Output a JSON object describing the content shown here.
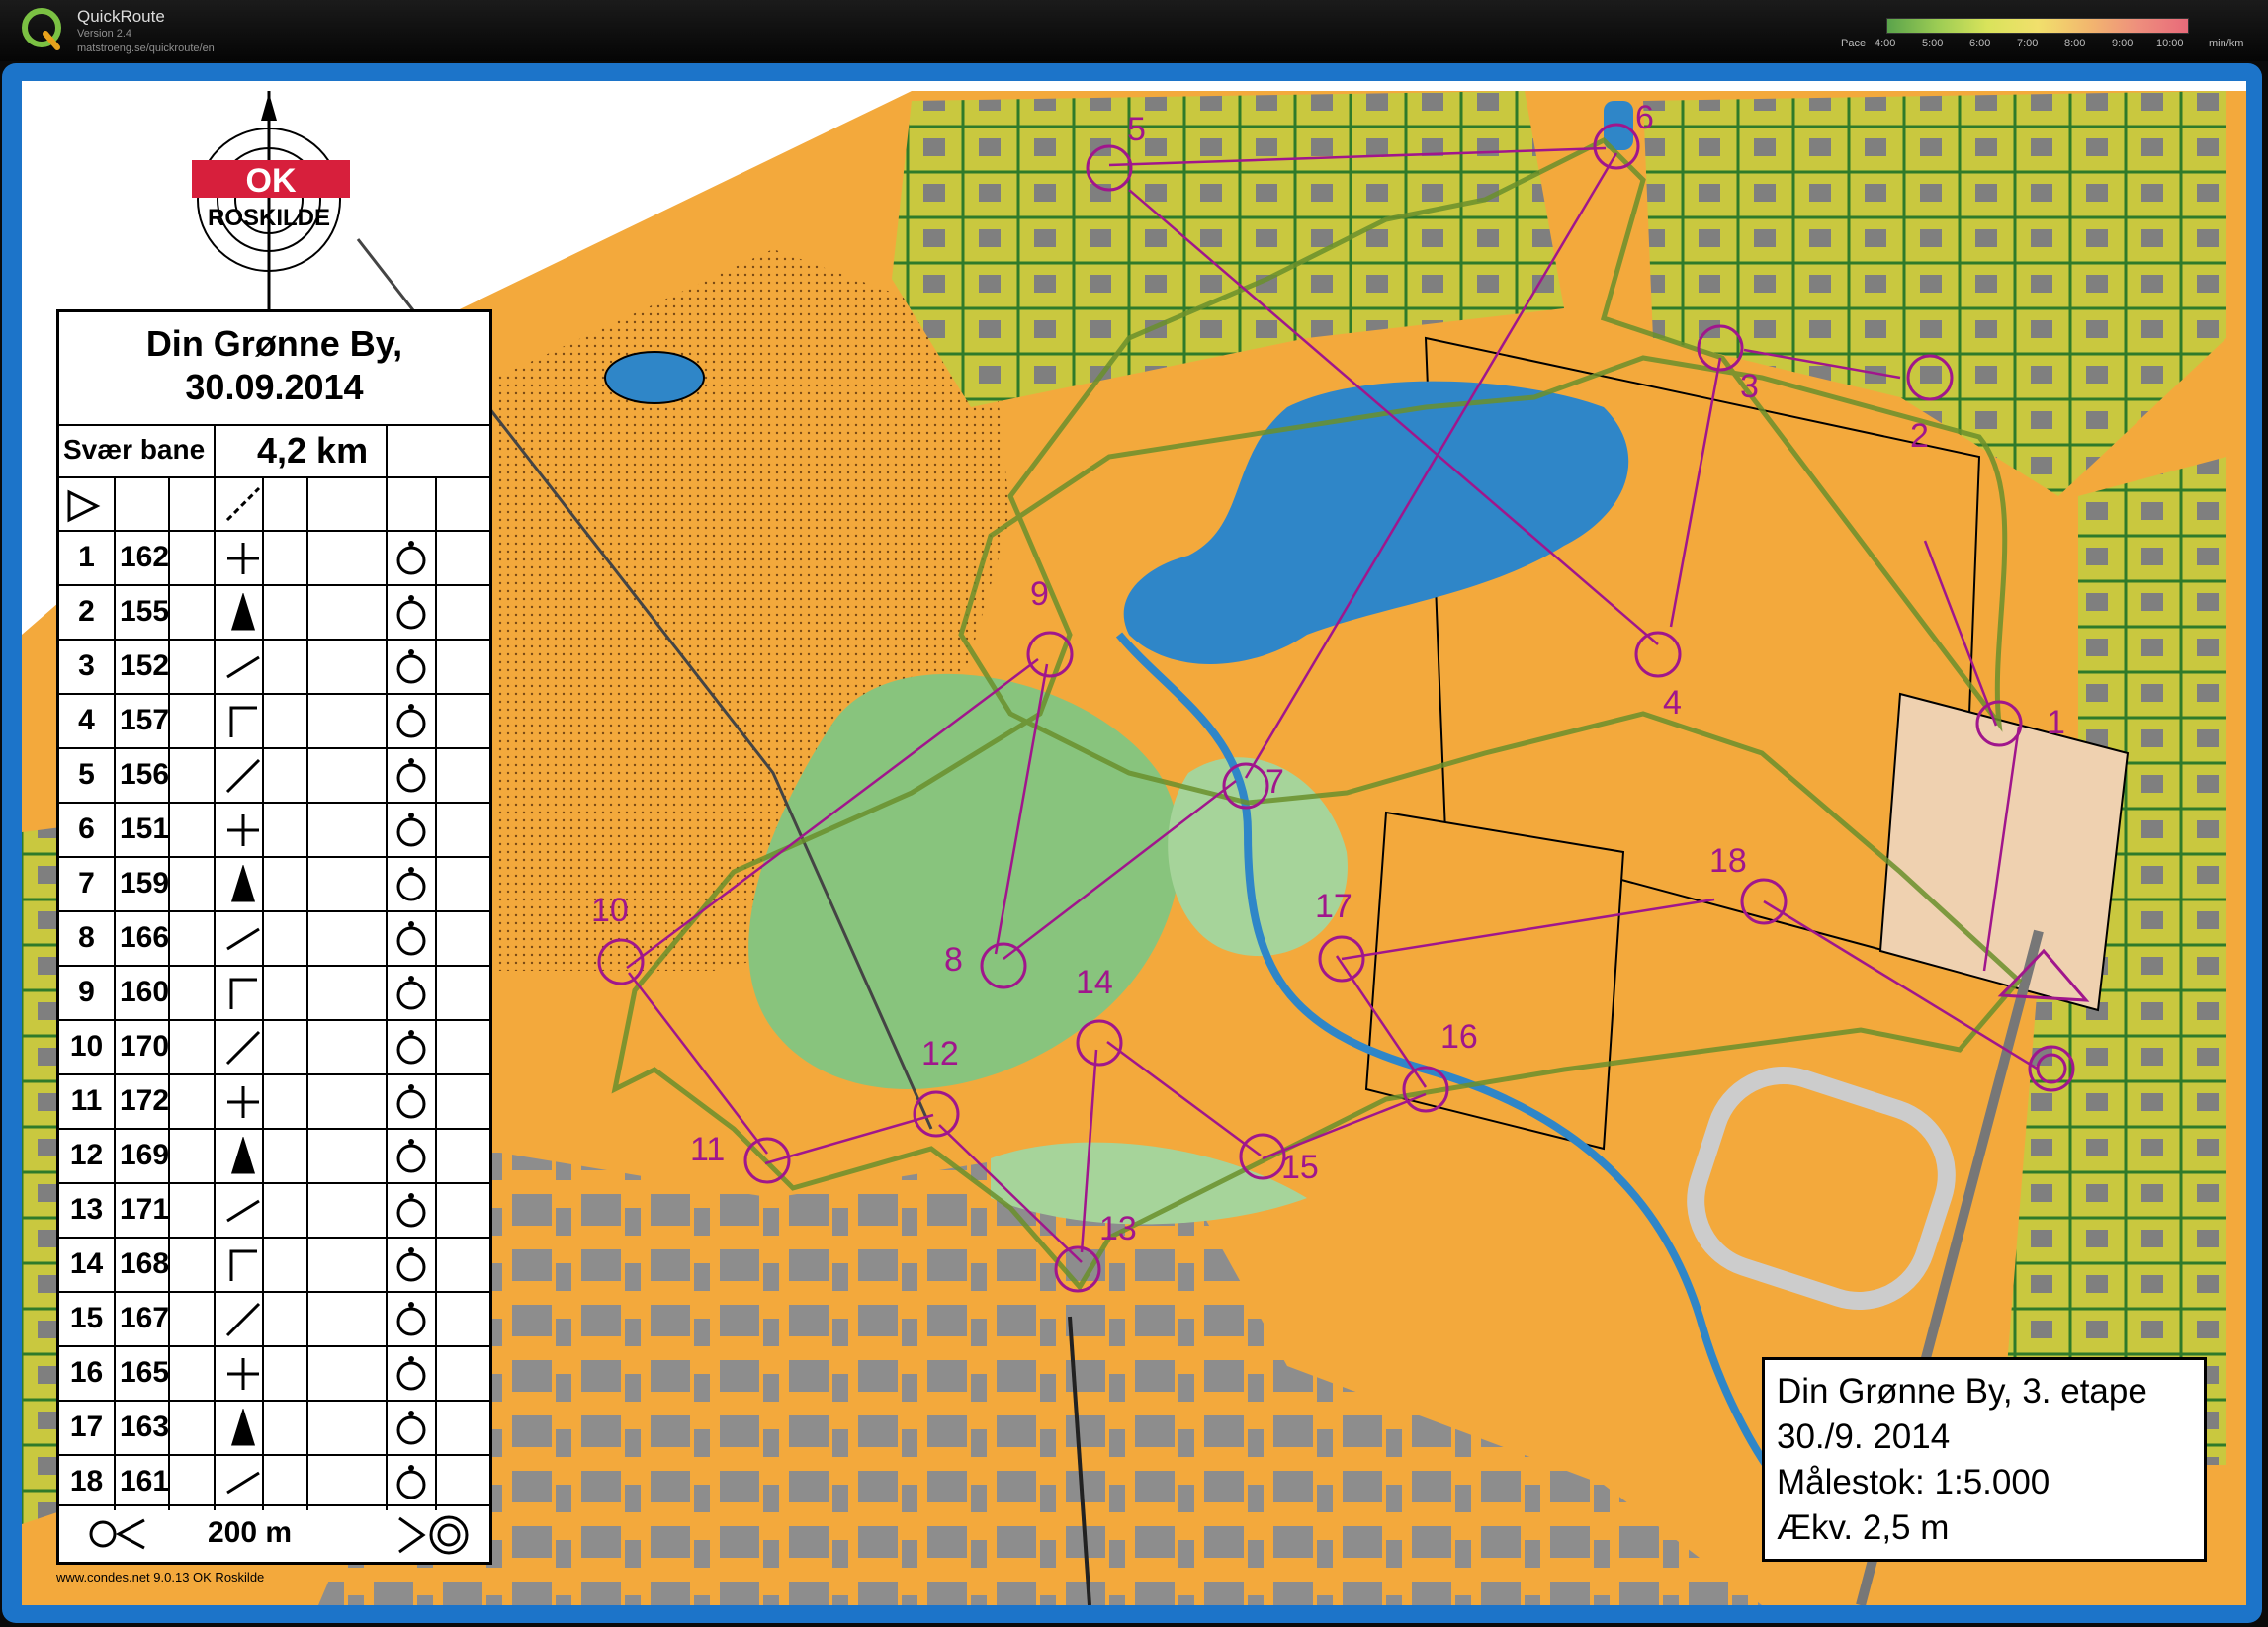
{
  "app": {
    "title": "QuickRoute",
    "version": "Version 2.4",
    "url": "matstroeng.se/quickroute/en"
  },
  "pace_scale": {
    "label": "Pace",
    "ticks": [
      "4:00",
      "5:00",
      "6:00",
      "7:00",
      "8:00",
      "9:00",
      "10:00"
    ],
    "unit": "min/km"
  },
  "colors": {
    "accent_frame": "#1c74c9",
    "course_magenta": "#a0168c",
    "route_blue": "#2b2fb8",
    "terrain_orange": "#f3a93c",
    "forest_green": "#88c47d",
    "water_blue": "#2f86c8",
    "building_gray": "#8d8d8d"
  },
  "map": {
    "club_logo": {
      "text": "ROSKILDE",
      "badge": "OK"
    },
    "controls": [
      {
        "label": "1"
      },
      {
        "label": "2"
      },
      {
        "label": "3"
      },
      {
        "label": "4"
      },
      {
        "label": "5"
      },
      {
        "label": "6"
      },
      {
        "label": "7"
      },
      {
        "label": "8"
      },
      {
        "label": "9"
      },
      {
        "label": "10"
      },
      {
        "label": "11"
      },
      {
        "label": "12"
      },
      {
        "label": "13"
      },
      {
        "label": "14"
      },
      {
        "label": "15"
      },
      {
        "label": "16"
      },
      {
        "label": "17"
      },
      {
        "label": "18"
      }
    ]
  },
  "control_description": {
    "title_line1": "Din Grønne By,",
    "title_line2": "30.09.2014",
    "course_name": "Svær bane",
    "course_length": "4,2 km",
    "rows": [
      {
        "num": "1",
        "code": "162"
      },
      {
        "num": "2",
        "code": "155"
      },
      {
        "num": "3",
        "code": "152"
      },
      {
        "num": "4",
        "code": "157"
      },
      {
        "num": "5",
        "code": "156"
      },
      {
        "num": "6",
        "code": "151"
      },
      {
        "num": "7",
        "code": "159"
      },
      {
        "num": "8",
        "code": "166"
      },
      {
        "num": "9",
        "code": "160"
      },
      {
        "num": "10",
        "code": "170"
      },
      {
        "num": "11",
        "code": "172"
      },
      {
        "num": "12",
        "code": "169"
      },
      {
        "num": "13",
        "code": "171"
      },
      {
        "num": "14",
        "code": "168"
      },
      {
        "num": "15",
        "code": "167"
      },
      {
        "num": "16",
        "code": "165"
      },
      {
        "num": "17",
        "code": "163"
      },
      {
        "num": "18",
        "code": "161"
      }
    ],
    "finish_distance": "200 m"
  },
  "info_box": {
    "line1": "Din Grønne By, 3. etape",
    "line2": "30./9. 2014",
    "line3": "Målestok: 1:5.000",
    "line4": "Ækv. 2,5 m"
  },
  "credit": "www.condes.net 9.0.13 OK Roskilde"
}
